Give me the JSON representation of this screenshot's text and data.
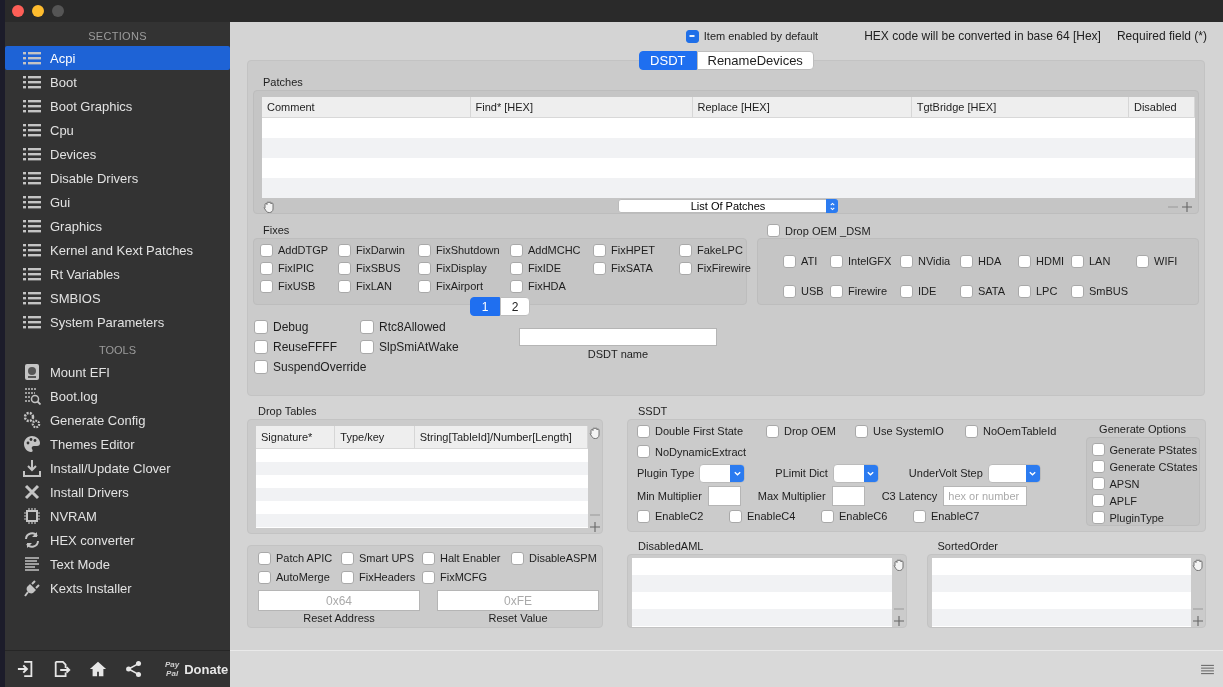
{
  "sidebar": {
    "sections_heading": "SECTIONS",
    "sections": [
      {
        "label": "Acpi",
        "selected": true
      },
      {
        "label": "Boot",
        "selected": false
      },
      {
        "label": "Boot Graphics",
        "selected": false
      },
      {
        "label": "Cpu",
        "selected": false
      },
      {
        "label": "Devices",
        "selected": false
      },
      {
        "label": "Disable Drivers",
        "selected": false
      },
      {
        "label": "Gui",
        "selected": false
      },
      {
        "label": "Graphics",
        "selected": false
      },
      {
        "label": "Kernel and Kext Patches",
        "selected": false
      },
      {
        "label": "Rt Variables",
        "selected": false
      },
      {
        "label": "SMBIOS",
        "selected": false
      },
      {
        "label": "System Parameters",
        "selected": false
      }
    ],
    "tools_heading": "TOOLS",
    "tools": [
      {
        "label": "Mount EFI",
        "selected": false
      },
      {
        "label": "Boot.log",
        "selected": false
      },
      {
        "label": "Generate Config",
        "selected": false
      },
      {
        "label": "Themes Editor",
        "selected": false
      },
      {
        "label": "Install/Update Clover",
        "selected": false
      },
      {
        "label": "Install Drivers",
        "selected": false
      },
      {
        "label": "NVRAM",
        "selected": false
      },
      {
        "label": "HEX converter",
        "selected": false
      },
      {
        "label": "Text Mode",
        "selected": false
      },
      {
        "label": "Kexts Installer",
        "selected": false
      }
    ],
    "donate": {
      "logo": [
        "Pay",
        "Pal"
      ],
      "label": "Donate"
    }
  },
  "header": {
    "item_enabled": {
      "label": "Item enabled by default",
      "checked": true,
      "mixed": true
    },
    "notes": [
      "HEX code will be converted in base 64 [Hex]",
      "Required field (*)"
    ]
  },
  "tabs": [
    {
      "label": "DSDT",
      "selected": true
    },
    {
      "label": "RenameDevices",
      "selected": false
    }
  ],
  "dsdt": {
    "patches": {
      "title": "Patches",
      "columns": [
        "Comment",
        "Find* [HEX]",
        "Replace [HEX]",
        "TgtBridge [HEX]",
        "Disabled"
      ],
      "popup": "List Of Patches"
    },
    "fixes": {
      "title": "Fixes",
      "items": [
        {
          "label": "AddDTGP",
          "checked": false
        },
        {
          "label": "FixDarwin",
          "checked": false
        },
        {
          "label": "FixShutdown",
          "checked": false
        },
        {
          "label": "AddMCHC",
          "checked": false
        },
        {
          "label": "FixHPET",
          "checked": false
        },
        {
          "label": "FakeLPC",
          "checked": false
        },
        {
          "label": "FixIPIC",
          "checked": false
        },
        {
          "label": "FixSBUS",
          "checked": false
        },
        {
          "label": "FixDisplay",
          "checked": false
        },
        {
          "label": "FixIDE",
          "checked": false
        },
        {
          "label": "FixSATA",
          "checked": false
        },
        {
          "label": "FixFirewire",
          "checked": false
        },
        {
          "label": "FixUSB",
          "checked": false
        },
        {
          "label": "FixLAN",
          "checked": false
        },
        {
          "label": "FixAirport",
          "checked": false
        },
        {
          "label": "FixHDA",
          "checked": false
        }
      ],
      "pages": [
        {
          "label": "1",
          "selected": true
        },
        {
          "label": "2",
          "selected": false
        }
      ]
    },
    "drop_oem_dsm": {
      "label": "Drop OEM _DSM",
      "checked": false,
      "items": [
        {
          "label": "ATI",
          "checked": false
        },
        {
          "label": "IntelGFX",
          "checked": false
        },
        {
          "label": "NVidia",
          "checked": false
        },
        {
          "label": "HDA",
          "checked": false
        },
        {
          "label": "HDMI",
          "checked": false
        },
        {
          "label": "LAN",
          "checked": false
        },
        {
          "label": "WIFI",
          "checked": false
        },
        {
          "label": "USB",
          "checked": false
        },
        {
          "label": "Firewire",
          "checked": false
        },
        {
          "label": "IDE",
          "checked": false
        },
        {
          "label": "SATA",
          "checked": false
        },
        {
          "label": "LPC",
          "checked": false
        },
        {
          "label": "SmBUS",
          "checked": false
        }
      ]
    },
    "options": [
      {
        "label": "Debug",
        "checked": false
      },
      {
        "label": "Rtc8Allowed",
        "checked": false
      },
      {
        "label": "ReuseFFFF",
        "checked": false
      },
      {
        "label": "SlpSmiAtWake",
        "checked": false
      },
      {
        "label": "SuspendOverride",
        "checked": false
      }
    ],
    "dsdt_name": {
      "label": "DSDT name"
    }
  },
  "drop_tables": {
    "title": "Drop Tables",
    "columns": [
      "Signature*",
      "Type/key",
      "String[TableId]/Number[Length]"
    ]
  },
  "ssdt": {
    "title": "SSDT",
    "options": [
      {
        "label": "Double First State",
        "checked": false
      },
      {
        "label": "Drop OEM",
        "checked": false
      },
      {
        "label": "Use SystemIO",
        "checked": false
      },
      {
        "label": "NoOemTableId",
        "checked": false
      },
      {
        "label": "NoDynamicExtract",
        "checked": false
      }
    ],
    "popups": [
      {
        "label": "Plugin Type"
      },
      {
        "label": "PLimit Dict"
      },
      {
        "label": "UnderVolt Step"
      }
    ],
    "fields": [
      {
        "label": "Min Multiplier"
      },
      {
        "label": "Max Multiplier"
      },
      {
        "label": "C3 Latency",
        "placeholder": "hex or number"
      }
    ],
    "c_states": [
      {
        "label": "EnableC2",
        "checked": false
      },
      {
        "label": "EnableC4",
        "checked": false
      },
      {
        "label": "EnableC6",
        "checked": false
      },
      {
        "label": "EnableC7",
        "checked": false
      }
    ],
    "generate_options": {
      "title": "Generate Options",
      "items": [
        {
          "label": "Generate PStates",
          "checked": false
        },
        {
          "label": "Generate CStates",
          "checked": false
        },
        {
          "label": "APSN",
          "checked": false
        },
        {
          "label": "APLF",
          "checked": false
        },
        {
          "label": "PluginType",
          "checked": false
        }
      ]
    }
  },
  "misc": {
    "options": [
      {
        "label": "Patch APIC",
        "checked": false
      },
      {
        "label": "Smart UPS",
        "checked": false
      },
      {
        "label": "Halt Enabler",
        "checked": false
      },
      {
        "label": "DisableASPM",
        "checked": false
      },
      {
        "label": "AutoMerge",
        "checked": false
      },
      {
        "label": "FixHeaders",
        "checked": false
      },
      {
        "label": "FixMCFG",
        "checked": false
      }
    ],
    "fields": [
      {
        "label": "Reset Address",
        "placeholder": "0x64"
      },
      {
        "label": "Reset Value",
        "placeholder": "0xFE"
      }
    ]
  },
  "lists": [
    {
      "title": "DisabledAML"
    },
    {
      "title": "SortedOrder"
    }
  ]
}
